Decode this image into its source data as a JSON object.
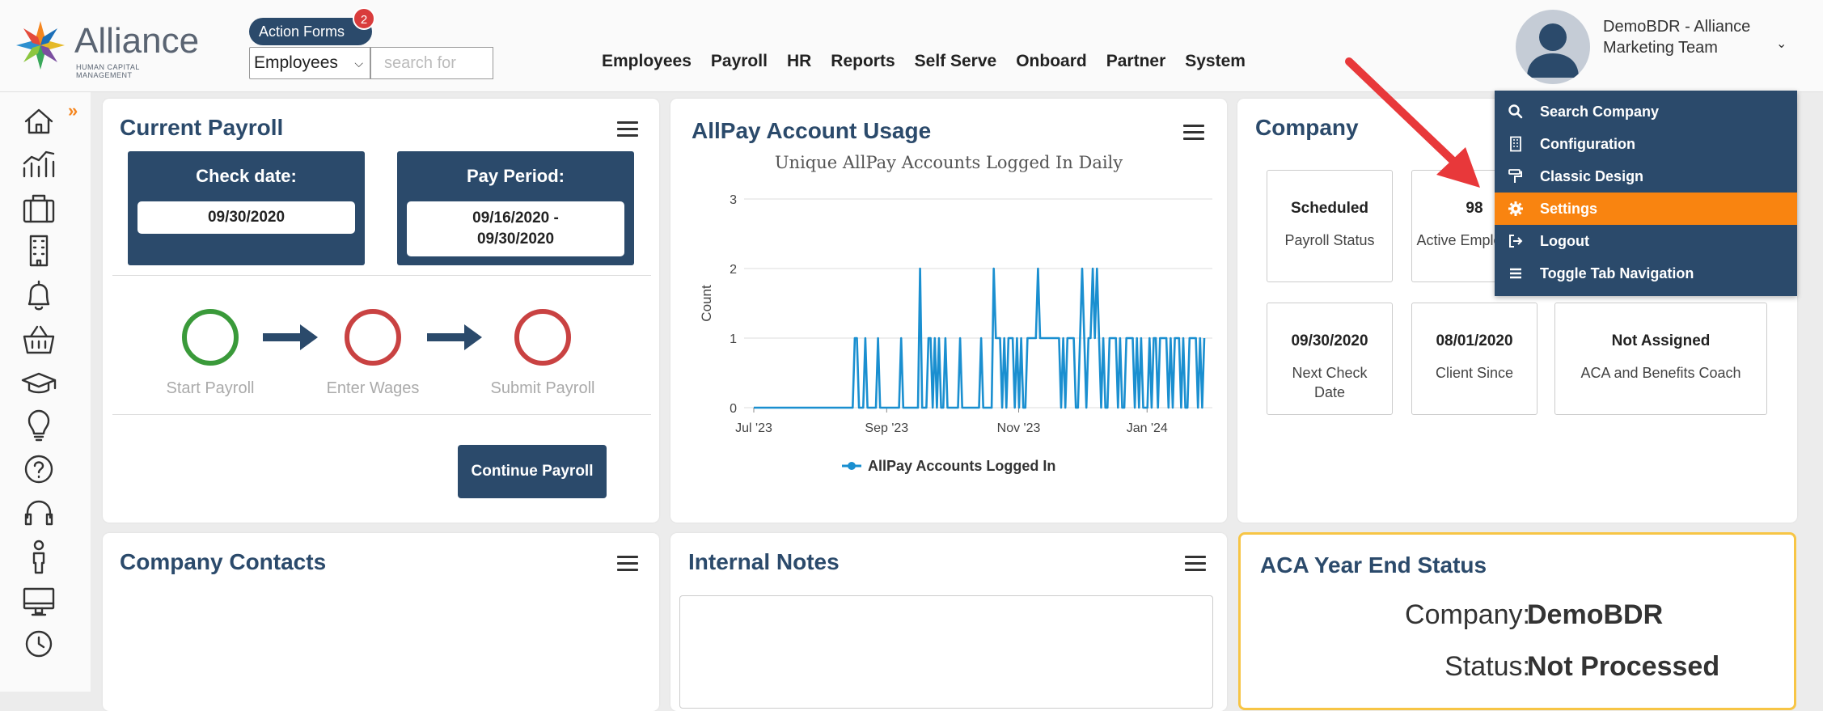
{
  "header": {
    "logo_text": "Alliance",
    "logo_subtitle": "HUMAN CAPITAL MANAGEMENT",
    "action_forms_label": "Action Forms",
    "action_forms_badge": "2",
    "search_scope": "Employees",
    "search_placeholder": "search for",
    "nav": [
      "Employees",
      "Payroll",
      "HR",
      "Reports",
      "Self Serve",
      "Onboard",
      "Partner",
      "System"
    ],
    "user_line1": "DemoBDR - Alliance",
    "user_line2": "Marketing Team"
  },
  "sidebar_icons": [
    "home-icon",
    "chart-line-icon",
    "briefcase-icon",
    "building-icon",
    "bell-icon",
    "basket-icon",
    "graduation-cap-icon",
    "lightbulb-icon",
    "help-circle-icon",
    "headset-icon",
    "person-icon",
    "monitor-icon",
    "clock-icon"
  ],
  "current_payroll": {
    "title": "Current Payroll",
    "check_date_label": "Check date:",
    "check_date_value": "09/30/2020",
    "pay_period_label": "Pay Period:",
    "pay_period_line1": "09/16/2020 -",
    "pay_period_line2": "09/30/2020",
    "steps": [
      "Start Payroll",
      "Enter Wages",
      "Submit Payroll"
    ],
    "continue_label": "Continue Payroll"
  },
  "allpay": {
    "title": "AllPay Account Usage"
  },
  "chart_data": {
    "type": "line",
    "title": "Unique AllPay Accounts Logged In Daily",
    "xlabel": "",
    "ylabel": "Count",
    "ylim": [
      0,
      3
    ],
    "yticks": [
      "0",
      "1",
      "2",
      "3"
    ],
    "xticks": [
      "Jul '23",
      "Sep '23",
      "Nov '23",
      "Jan '24"
    ],
    "series": [
      {
        "name": "AllPay Accounts Logged In",
        "values": [
          0,
          0,
          0,
          0,
          0,
          0,
          0,
          0,
          0,
          0,
          0,
          0,
          0,
          0,
          0,
          0,
          0,
          0,
          0,
          0,
          0,
          0,
          0,
          0,
          0,
          0,
          0,
          0,
          0,
          0,
          0,
          0,
          0,
          0,
          0,
          0,
          0,
          0,
          0,
          0,
          0,
          0,
          0,
          0,
          0,
          0,
          0,
          0,
          1,
          1,
          0,
          0,
          0,
          1,
          0,
          0,
          0,
          0,
          0,
          1,
          0,
          0,
          0,
          0,
          0,
          0,
          0,
          0,
          0,
          0,
          1,
          0,
          0,
          0,
          0,
          0,
          0,
          0,
          0,
          2,
          0,
          0,
          0,
          1,
          1,
          0,
          1,
          0,
          1,
          0,
          0,
          1,
          0,
          0,
          0,
          0,
          0,
          0,
          1,
          0,
          0,
          0,
          0,
          0,
          0,
          0,
          0,
          0,
          1,
          0,
          0,
          0,
          0,
          0,
          2,
          1,
          1,
          1,
          0,
          1,
          0,
          1,
          1,
          1,
          0,
          1,
          0,
          1,
          0,
          0,
          1,
          1,
          1,
          1,
          1,
          2,
          1,
          1,
          1,
          1,
          1,
          1,
          1,
          1,
          1,
          1,
          0,
          1,
          0,
          1,
          1,
          1,
          1,
          0,
          0,
          1,
          2,
          1,
          0,
          1,
          1,
          2,
          1,
          2,
          1,
          0,
          1,
          0,
          0,
          1,
          1,
          1,
          1,
          0,
          1,
          0,
          0,
          1,
          1,
          1,
          1,
          0,
          1,
          0,
          1,
          0,
          0,
          0,
          1,
          0,
          1,
          1,
          0,
          1,
          1,
          1,
          1,
          0,
          1,
          0,
          1,
          1,
          1,
          0,
          1,
          0,
          0,
          1,
          1,
          1,
          1,
          0,
          1,
          0,
          1
        ]
      }
    ],
    "series_color": "#1a8fd0",
    "grid": true,
    "legend": "bottom"
  },
  "company": {
    "title": "Company",
    "stats": [
      {
        "value": "Scheduled",
        "label": "Payroll Status"
      },
      {
        "value": "98",
        "label": "Active Employees"
      },
      {
        "value": "09/30/2020",
        "label": "Next Check Date"
      },
      {
        "value": "08/01/2020",
        "label": "Client Since"
      },
      {
        "value": "Not Assigned",
        "label": "ACA and Benefits Coach"
      }
    ]
  },
  "user_menu": [
    {
      "icon": "search-icon",
      "label": "Search Company",
      "active": false
    },
    {
      "icon": "building-icon",
      "label": "Configuration",
      "active": false
    },
    {
      "icon": "paint-roller-icon",
      "label": "Classic Design",
      "active": false
    },
    {
      "icon": "gear-icon",
      "label": "Settings",
      "active": true
    },
    {
      "icon": "logout-icon",
      "label": "Logout",
      "active": false
    },
    {
      "icon": "menu-icon",
      "label": "Toggle Tab Navigation",
      "active": false
    }
  ],
  "company_contacts": {
    "title": "Company Contacts"
  },
  "internal_notes": {
    "title": "Internal Notes"
  },
  "aca": {
    "title": "ACA Year End Status",
    "company_label": "Company:",
    "company_value": "DemoBDR",
    "status_label": "Status:",
    "status_value": "Not Processed"
  },
  "colors": {
    "brand_navy": "#2b4a6b",
    "accent_orange": "#f98410",
    "step_start": "#3a9a3a",
    "step_pending": "#c94242",
    "aca_border": "#f7c545",
    "annotation_arrow": "#e8383a"
  }
}
